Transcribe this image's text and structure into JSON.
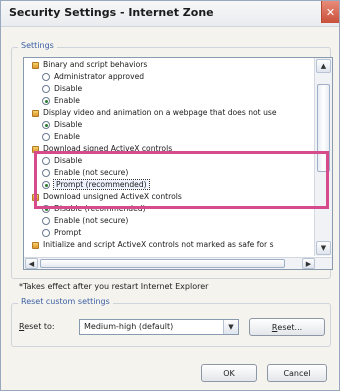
{
  "window": {
    "title": "Security Settings - Internet Zone",
    "close_glyph": "✕"
  },
  "settings": {
    "group_label": "Settings",
    "rows": [
      {
        "kind": "header",
        "text": "Binary and script behaviors"
      },
      {
        "kind": "option",
        "text": "Administrator approved",
        "checked": false
      },
      {
        "kind": "option",
        "text": "Disable",
        "checked": false
      },
      {
        "kind": "option",
        "text": "Enable",
        "checked": true
      },
      {
        "kind": "header",
        "text": "Display video and animation on a webpage that does not use"
      },
      {
        "kind": "option",
        "text": "Disable",
        "checked": true
      },
      {
        "kind": "option",
        "text": "Enable",
        "checked": false
      },
      {
        "kind": "header",
        "text": "Download signed ActiveX controls"
      },
      {
        "kind": "option",
        "text": "Disable",
        "checked": false
      },
      {
        "kind": "option",
        "text": "Enable (not secure)",
        "checked": false
      },
      {
        "kind": "option",
        "text": "Prompt (recommended)",
        "checked": true
      },
      {
        "kind": "header",
        "text": "Download unsigned ActiveX controls"
      },
      {
        "kind": "option",
        "text": "Disable (recommended)",
        "checked": true
      },
      {
        "kind": "option",
        "text": "Enable (not secure)",
        "checked": false
      },
      {
        "kind": "option",
        "text": "Prompt",
        "checked": false
      },
      {
        "kind": "header",
        "text": "Initialize and script ActiveX controls not marked as safe for s"
      }
    ],
    "scroll_up": "▲",
    "scroll_down": "▼",
    "scroll_left": "◀",
    "scroll_right": "▶"
  },
  "note": "*Takes effect after you restart Internet Explorer",
  "reset": {
    "group_label": "Reset custom settings",
    "label_first": "R",
    "label_rest": "eset to:",
    "selected": "Medium-high (default)",
    "dropdown_glyph": "▼",
    "button_first": "R",
    "button_rest": "eset..."
  },
  "buttons": {
    "ok": "OK",
    "cancel": "Cancel"
  },
  "colors": {
    "highlight": "#d64b8c",
    "accent": "#3c5fa3"
  }
}
